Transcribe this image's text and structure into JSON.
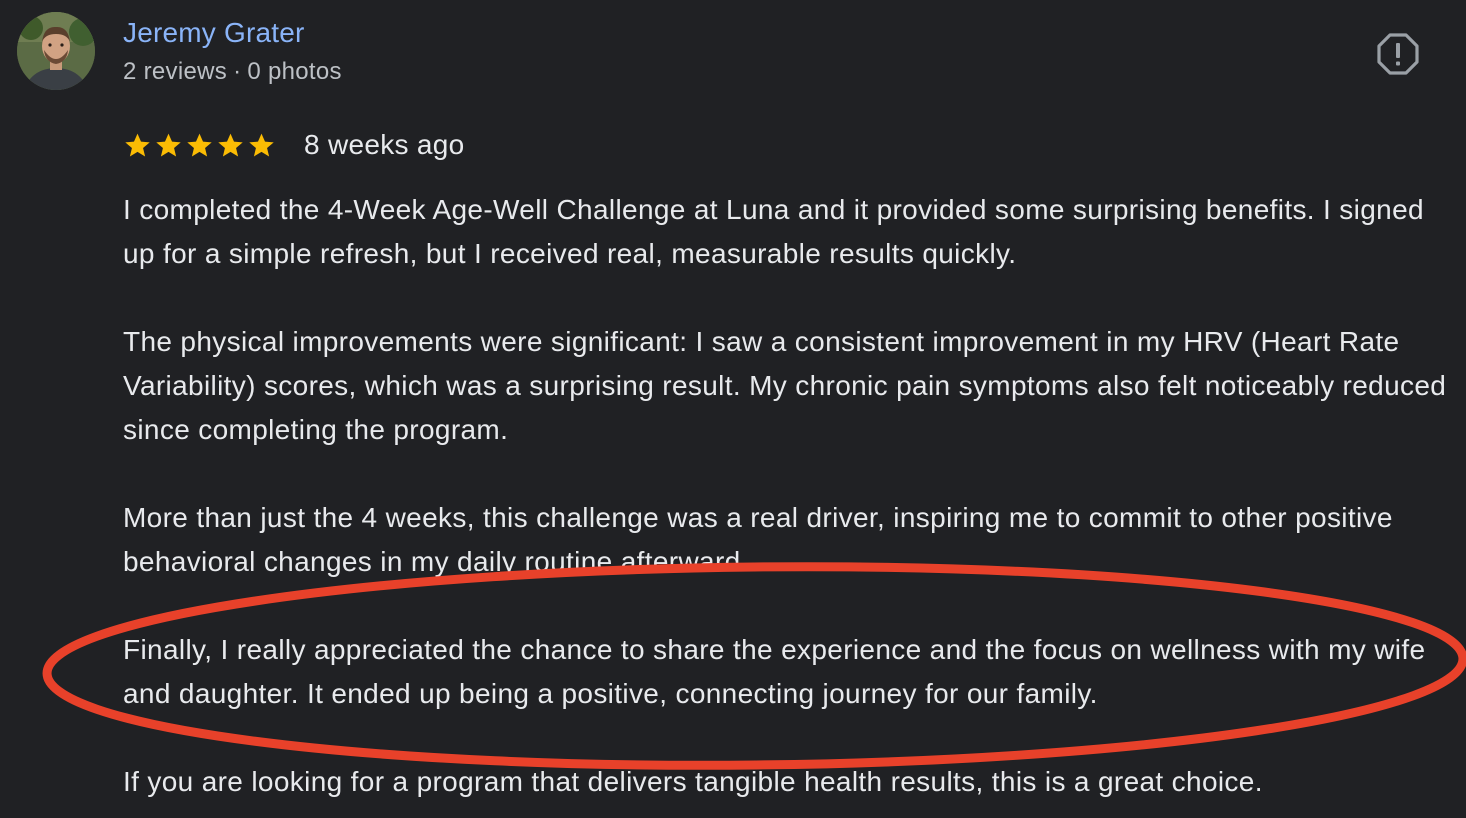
{
  "review": {
    "author": {
      "name": "Jeremy Grater",
      "reviews_count": "2 reviews",
      "separator": "·",
      "photos_count": "0 photos"
    },
    "rating": 5,
    "rating_max": 5,
    "date": "8 weeks ago",
    "paragraphs": [
      "I completed the 4-Week Age-Well Challenge at Luna and it provided some surprising benefits. I signed up for a simple refresh, but I received real, measurable results quickly.",
      "The physical improvements were significant: I saw a consistent improvement in my HRV (Heart Rate Variability) scores, which was a surprising result. My chronic pain symptoms also felt noticeably reduced since completing the program.",
      "More than just the 4 weeks, this challenge was a real driver, inspiring me to commit to other positive behavioral changes in my daily routine afterward.",
      "Finally, I really appreciated the chance to share the experience and the focus on wellness with my wife and daughter. It ended up being a positive, connecting journey for our family.",
      "If you are looking for a program that delivers tangible health results, this is a great choice."
    ]
  },
  "icons": {
    "report": "report-icon",
    "star": "star-icon",
    "avatar": "avatar-photo"
  },
  "colors": {
    "background": "#202124",
    "author_name": "#8ab4f8",
    "meta_text": "#bdc1c6",
    "body_text": "#e8eaed",
    "star": "#fbbc04",
    "annotation_ellipse": "#e8412a",
    "report_icon": "#9aa0a6"
  }
}
